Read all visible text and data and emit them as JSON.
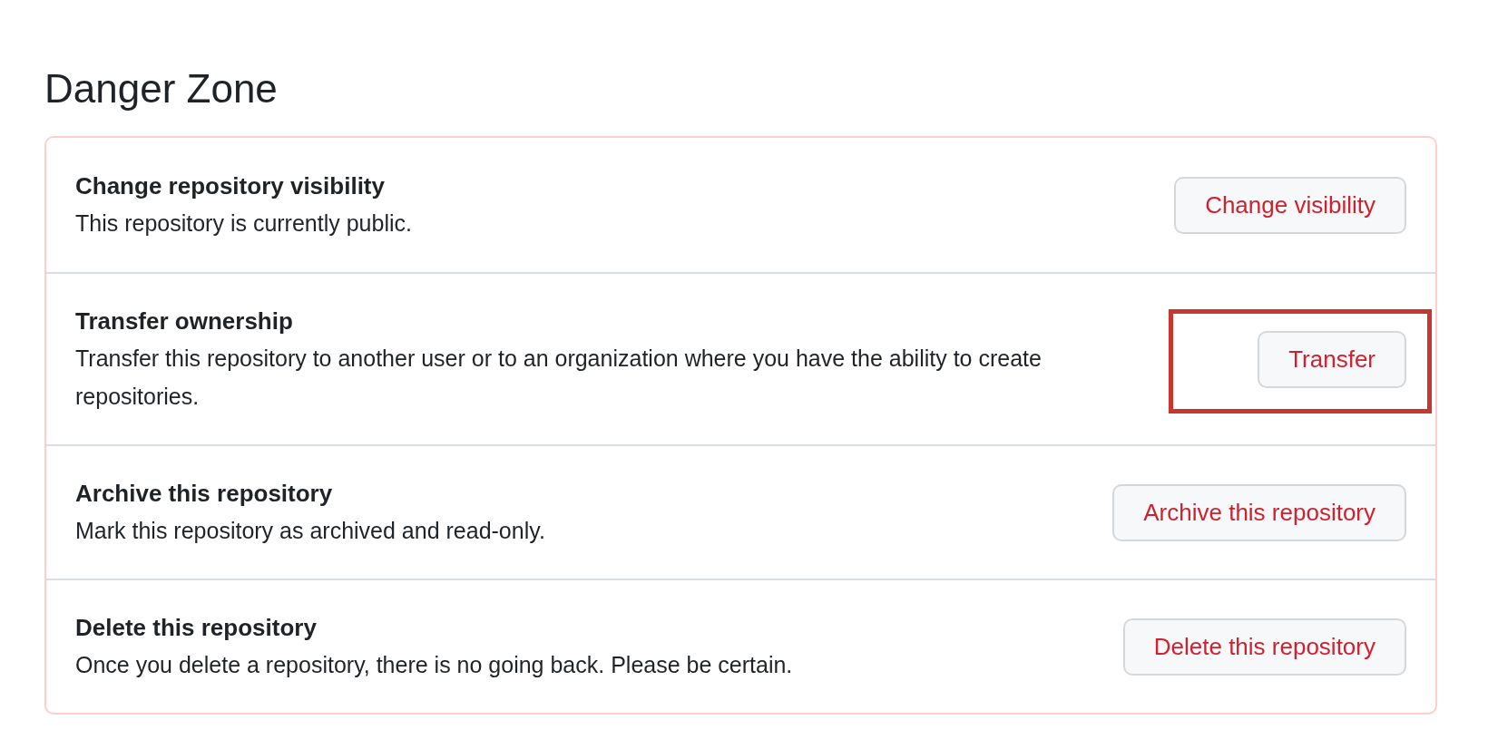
{
  "title": "Danger Zone",
  "rows": [
    {
      "heading": "Change repository visibility",
      "description": "This repository is currently public.",
      "button": "Change visibility",
      "highlighted": false
    },
    {
      "heading": "Transfer ownership",
      "description": "Transfer this repository to another user or to an organization where you have the ability to create repositories.",
      "button": "Transfer",
      "highlighted": true
    },
    {
      "heading": "Archive this repository",
      "description": "Mark this repository as archived and read-only.",
      "button": "Archive this repository",
      "highlighted": false
    },
    {
      "heading": "Delete this repository",
      "description": "Once you delete a repository, there is no going back. Please be certain.",
      "button": "Delete this repository",
      "highlighted": false
    }
  ]
}
